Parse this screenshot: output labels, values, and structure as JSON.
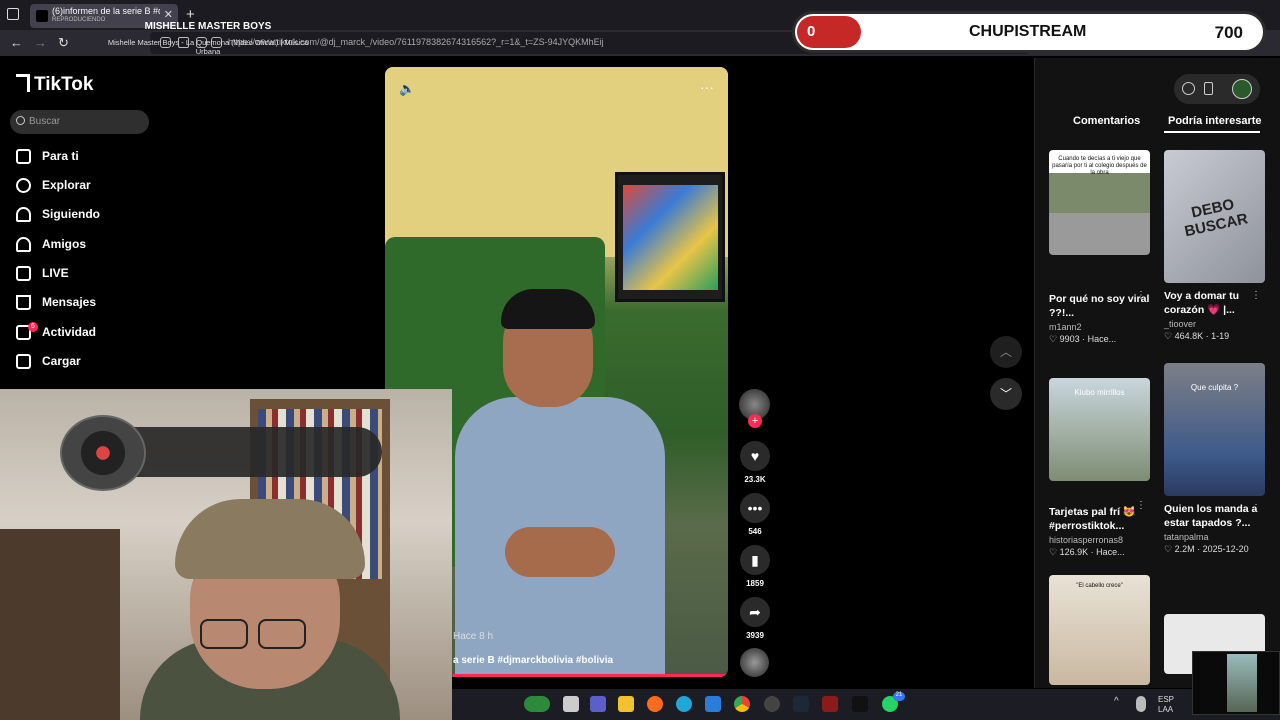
{
  "browser": {
    "tab_title": "(6)informen de la serie B #djma",
    "tab_status": "REPRODUCIENDO",
    "url": "https://www.tiktok.com/@dj_marck_/video/7611978382674316562?_r=1&_t=ZS-94JYQKMhEij"
  },
  "stream_overlay": {
    "left_count": "0",
    "name": "CHUPISTREAM",
    "right_count": "700"
  },
  "tiktok": {
    "logo": "TikTok",
    "search_placeholder": "Buscar",
    "nav": [
      {
        "label": "Para ti"
      },
      {
        "label": "Explorar"
      },
      {
        "label": "Siguiendo"
      },
      {
        "label": "Amigos"
      },
      {
        "label": "LIVE"
      },
      {
        "label": "Mensajes"
      },
      {
        "label": "Actividad",
        "badge": "6"
      },
      {
        "label": "Cargar"
      }
    ]
  },
  "video": {
    "time": "Hace 8 h",
    "caption": "a serie B #djmarckbolivia #bolivia",
    "likes": "23.3K",
    "comments": "546",
    "saves": "1859",
    "shares": "3939"
  },
  "right_panel": {
    "tabs": [
      "Comentarios",
      "Podría interesarte"
    ],
    "cards": [
      {
        "title": "Por qué no soy viral ??!...",
        "author": "m1ann2",
        "likes": "9903",
        "date": "Hace...",
        "overlay": "Cuando te decías a ti viejo que pasaría por ti al colegio después de la obra"
      },
      {
        "title": "Voy a domar tu corazón 💗 |...",
        "author": "_tioover",
        "likes": "464.8K",
        "date": "1-19",
        "overlay": "DEBO BUSCAR"
      },
      {
        "title": "Tarjetas pal frí 😻 #perrostiktok...",
        "author": "historiasperronas8",
        "likes": "126.9K",
        "date": "Hace...",
        "overlay": "Kiubo mirrillos"
      },
      {
        "title": "Quien los manda a estar tapados ?...",
        "author": "tatanpalma",
        "likes": "2.2M",
        "date": "2025-12-20",
        "overlay": "Que culpita ?"
      },
      {
        "title": "",
        "author": "",
        "likes": "",
        "date": "",
        "overlay": "\"El cabello crece\""
      }
    ]
  },
  "music_widget": {
    "artist": "MISHELLE MASTER BOYS",
    "song": "Mishelle Master Boys - La Quemona (Video Oficial) | Música Urbana"
  },
  "taskbar": {
    "lang": "ESP",
    "layout": "LAA",
    "whatsapp_badge": "21"
  }
}
